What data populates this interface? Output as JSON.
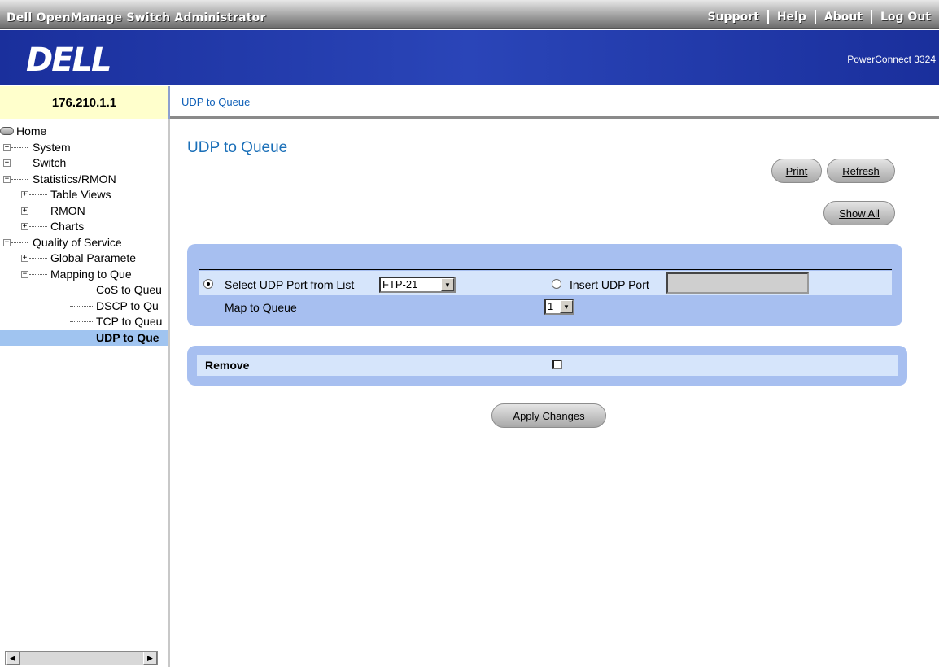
{
  "header": {
    "app_title": "Dell OpenManage Switch Administrator",
    "links": [
      "Support",
      "Help",
      "About",
      "Log Out"
    ],
    "logo_text": "DELL",
    "product": "PowerConnect 3324"
  },
  "device": {
    "ip": "176.210.1.1"
  },
  "breadcrumb": "UDP to Queue",
  "tree": [
    {
      "label": "Home"
    },
    {
      "label": "System"
    },
    {
      "label": "Switch"
    },
    {
      "label": "Statistics/RMON"
    },
    {
      "label": "Table Views"
    },
    {
      "label": "RMON"
    },
    {
      "label": "Charts"
    },
    {
      "label": "Quality of Service"
    },
    {
      "label": "Global Paramete"
    },
    {
      "label": "Mapping to Que"
    },
    {
      "label": "CoS to Queu"
    },
    {
      "label": "DSCP to Qu"
    },
    {
      "label": "TCP to Queu"
    },
    {
      "label": "UDP to Que"
    }
  ],
  "main": {
    "title": "UDP to Queue",
    "print_label": "Print",
    "refresh_label": "Refresh",
    "show_all_label": "Show All",
    "form": {
      "select_label": "Select UDP Port from List",
      "port_value": "FTP-21",
      "insert_label": "Insert UDP Port",
      "insert_value": "",
      "map_label": "Map to Queue",
      "queue_value": "1",
      "remove_label": "Remove",
      "remove_checked": false,
      "mode": "select-from-list"
    },
    "apply_label": "Apply Changes"
  },
  "colors": {
    "banner": "#1a2f9c",
    "title": "#1a6fb8",
    "panel": "#a7bff0",
    "selection": "#a0c4f0"
  }
}
